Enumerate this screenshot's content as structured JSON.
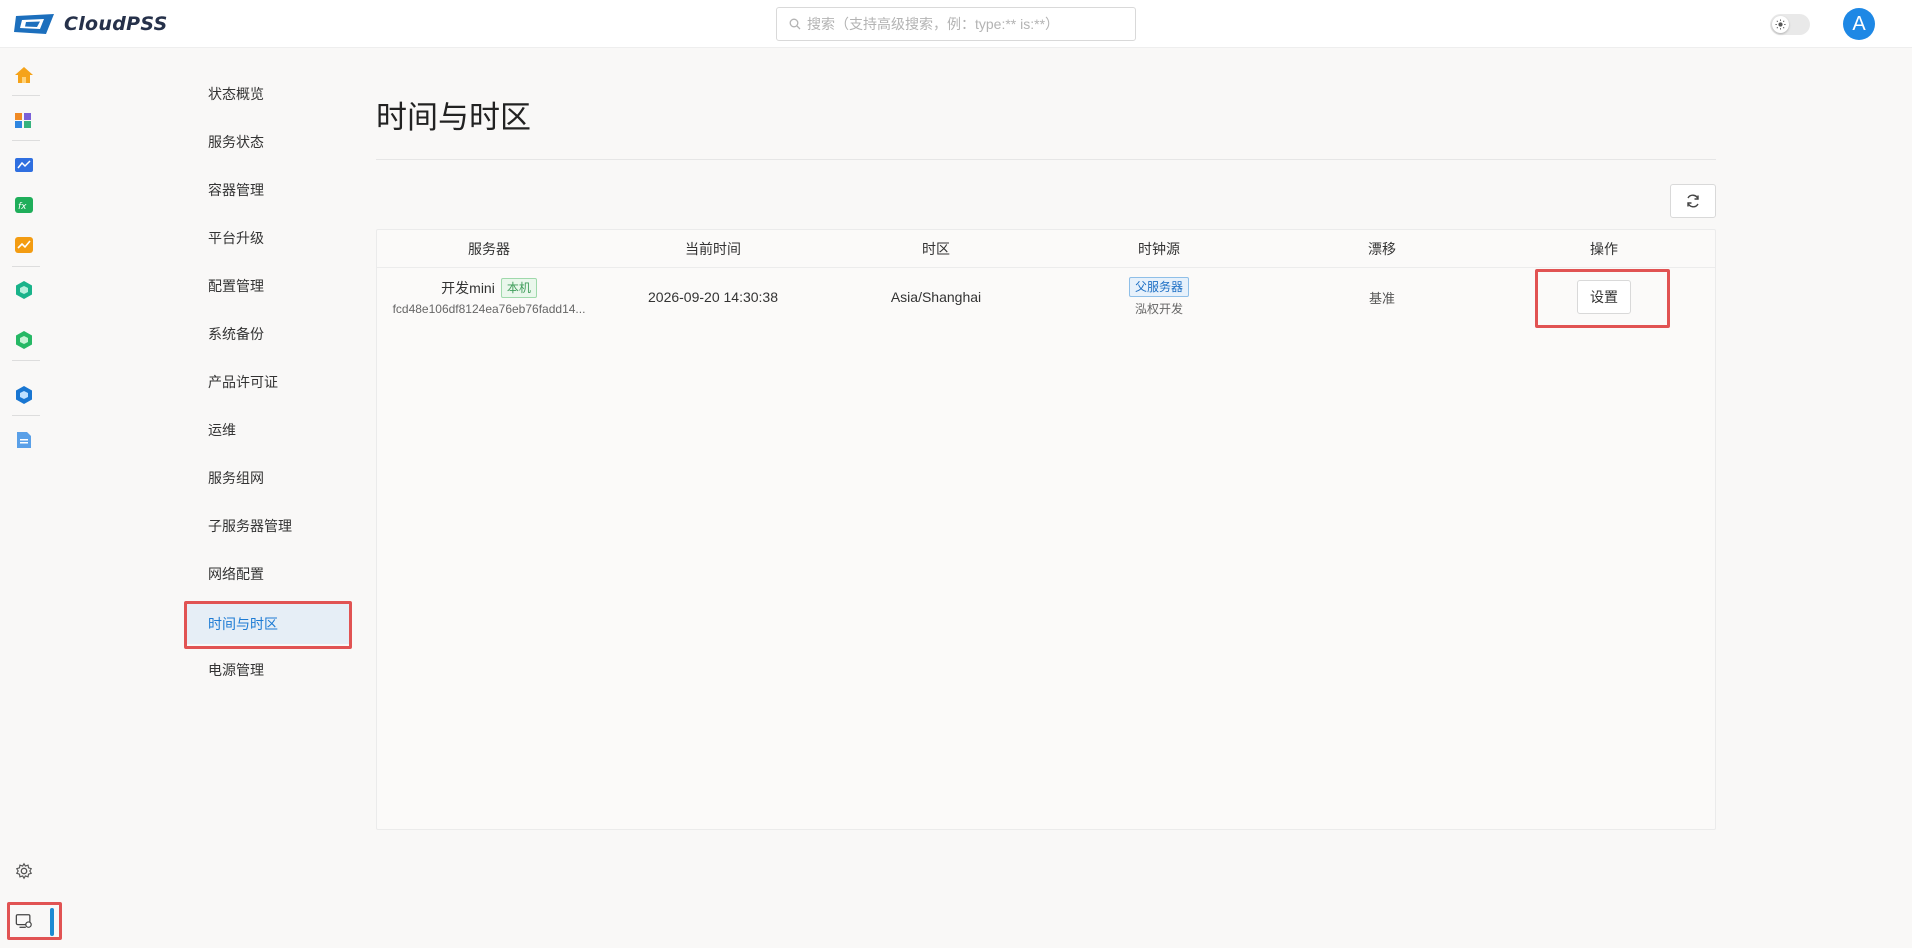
{
  "app": {
    "logo_text": "CloudPSS",
    "search_placeholder": "搜索（支持高级搜索，例：type:** is:**）",
    "avatar_letter": "A",
    "colors": {
      "accent": "#1d7bd4",
      "highlight_box": "#e15353",
      "tag_green": "#3f9d5a",
      "tag_blue": "#1d6fc4"
    }
  },
  "rail": {
    "icons": [
      "home-icon",
      "apps-icon",
      "chart-window-icon",
      "function-icon",
      "analytics-icon",
      "hexagon-green-icon",
      "hexagon-green-2-icon",
      "hexagon-blue-icon",
      "document-icon",
      "settings-icon",
      "system-admin-icon"
    ]
  },
  "submenu": {
    "items": [
      {
        "label": "状态概览"
      },
      {
        "label": "服务状态"
      },
      {
        "label": "容器管理"
      },
      {
        "label": "平台升级"
      },
      {
        "label": "配置管理"
      },
      {
        "label": "系统备份"
      },
      {
        "label": "产品许可证"
      },
      {
        "label": "运维"
      },
      {
        "label": "服务组网"
      },
      {
        "label": "子服务器管理"
      },
      {
        "label": "网络配置"
      },
      {
        "label": "时间与时区"
      },
      {
        "label": "电源管理"
      }
    ],
    "active_label": "时间与时区"
  },
  "main": {
    "title": "时间与时区",
    "table": {
      "headers": [
        "服务器",
        "当前时间",
        "时区",
        "时钟源",
        "漂移",
        "操作"
      ],
      "rows": [
        {
          "server_name": "开发mini",
          "server_tag": "本机",
          "server_id": "fcd48e106df8124ea76eb76fadd14...",
          "current_time": "2026-09-20 14:30:38",
          "timezone": "Asia/Shanghai",
          "clock_source_tag": "父服务器",
          "clock_source_sub": "泓权开发",
          "drift": "基准",
          "action_label": "设置"
        }
      ]
    }
  }
}
